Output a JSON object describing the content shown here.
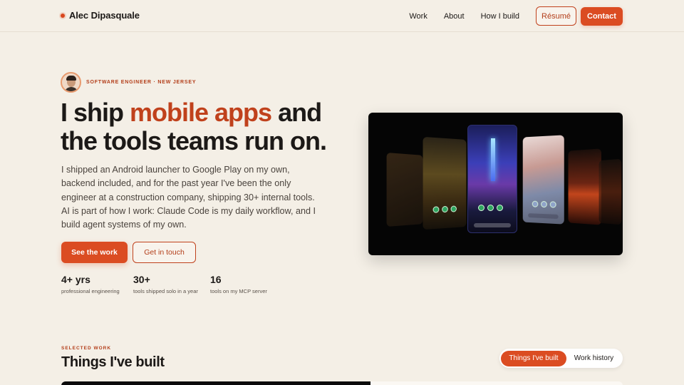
{
  "header": {
    "brand_name": "Alec Dipasquale",
    "nav": [
      "Work",
      "About",
      "How I build"
    ],
    "resume_label": "Résumé",
    "contact_label": "Contact"
  },
  "hero": {
    "eyebrow": "SOFTWARE ENGINEER · NEW JERSEY",
    "headline_part1": "I ship ",
    "headline_accent": "mobile apps",
    "headline_part2": " and the tools teams run on.",
    "lede": "I shipped an Android launcher to Google Play on my own, backend included, and for the past year I've been the only engineer at a construction company, shipping 30+ internal tools. AI is part of how I work: Claude Code is my daily workflow, and I build agent systems of my own.",
    "primary_cta": "See the work",
    "secondary_cta": "Get in touch",
    "stats": [
      {
        "value": "4+ yrs",
        "label": "professional engineering"
      },
      {
        "value": "30+",
        "label": "tools shipped solo in a year"
      },
      {
        "value": "16",
        "label": "tools on my MCP server"
      }
    ]
  },
  "section": {
    "eyebrow": "SELECTED WORK",
    "title": "Things I've built",
    "toggle_active": "Things I've built",
    "toggle_inactive": "Work history"
  },
  "colors": {
    "accent": "#db4c22",
    "background": "#f4efe6",
    "text": "#1c1917"
  }
}
